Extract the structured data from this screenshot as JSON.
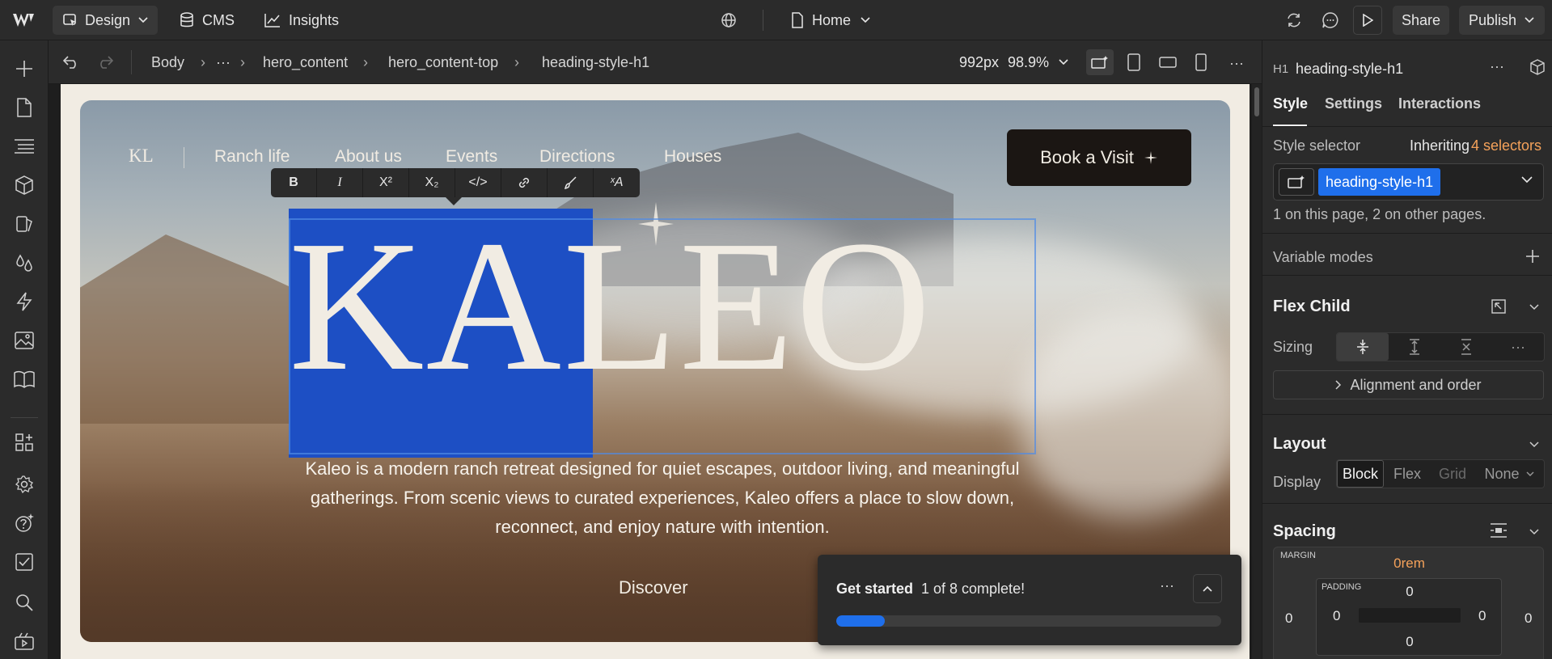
{
  "topbar": {
    "mode_label": "Design",
    "cms_label": "CMS",
    "insights_label": "Insights",
    "page_label": "Home",
    "share_label": "Share",
    "publish_label": "Publish"
  },
  "breadcrumb": {
    "items": [
      "Body",
      "hero_content",
      "hero_content-top",
      "heading-style-h1"
    ],
    "ellipsis": "···"
  },
  "viewport": {
    "width_label": "992px",
    "zoom_label": "98.9%"
  },
  "site": {
    "logo": "KL",
    "nav": [
      "Ranch life",
      "About us",
      "Events",
      "Directions",
      "Houses"
    ],
    "cta_label": "Book a Visit",
    "heading": "KALEO",
    "subtitle_lines": [
      "Kaleo is a modern ranch retreat designed for quiet escapes, outdoor living, and meaningful",
      "gatherings. From scenic views to curated experiences, Kaleo offers a place to slow down,",
      "reconnect, and enjoy nature with intention."
    ],
    "discover_label": "Discover"
  },
  "rich_text_toolbar": [
    "B",
    "I",
    "X²",
    "X₂",
    "</>",
    "link",
    "brush",
    "ˣA"
  ],
  "get_started": {
    "title": "Get started",
    "progress_text": "1 of 8 complete!",
    "progress": 0.125
  },
  "panel": {
    "element_tag": "H1",
    "element_name": "heading-style-h1",
    "tabs": [
      "Style",
      "Settings",
      "Interactions"
    ],
    "style_selector_label": "Style selector",
    "inheriting_label": "Inheriting",
    "selectors_count_label": "4 selectors",
    "class_chip": "heading-style-h1",
    "usage_text": "1 on this page, 2 on other pages.",
    "variable_modes_label": "Variable modes",
    "flex_child_label": "Flex Child",
    "sizing_label": "Sizing",
    "alignment_label": "Alignment and order",
    "layout_label": "Layout",
    "display_label": "Display",
    "display_options": [
      "Block",
      "Flex",
      "Grid",
      "None"
    ],
    "spacing_label": "Spacing",
    "margin_label": "MARGIN",
    "padding_label": "PADDING",
    "margin_top": "0rem",
    "margin_left": "0",
    "margin_right": "0",
    "padding_top": "0",
    "padding_left": "0",
    "padding_right": "0",
    "padding_bottom": "0"
  },
  "colors": {
    "accent_blue": "#1d4fc4",
    "orange": "#f5a25a",
    "progress_blue": "#1f6feb"
  }
}
